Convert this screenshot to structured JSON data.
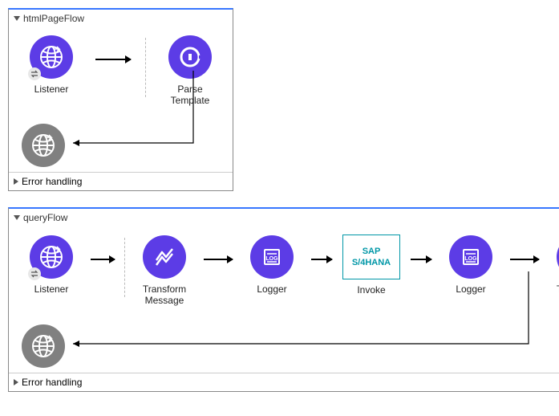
{
  "flows": [
    {
      "name": "htmlPageFlow",
      "errorSection": "Error handling",
      "nodes": {
        "listener": "Listener",
        "parseTemplate": "Parse Template"
      }
    },
    {
      "name": "queryFlow",
      "errorSection": "Error handling",
      "nodes": {
        "listener": "Listener",
        "transform1": "Transform Message",
        "logger1": "Logger",
        "invoke": "Invoke",
        "sapLabel": "SAP S/4HANA",
        "logger2": "Logger",
        "transform2": "Transform Message"
      }
    }
  ]
}
